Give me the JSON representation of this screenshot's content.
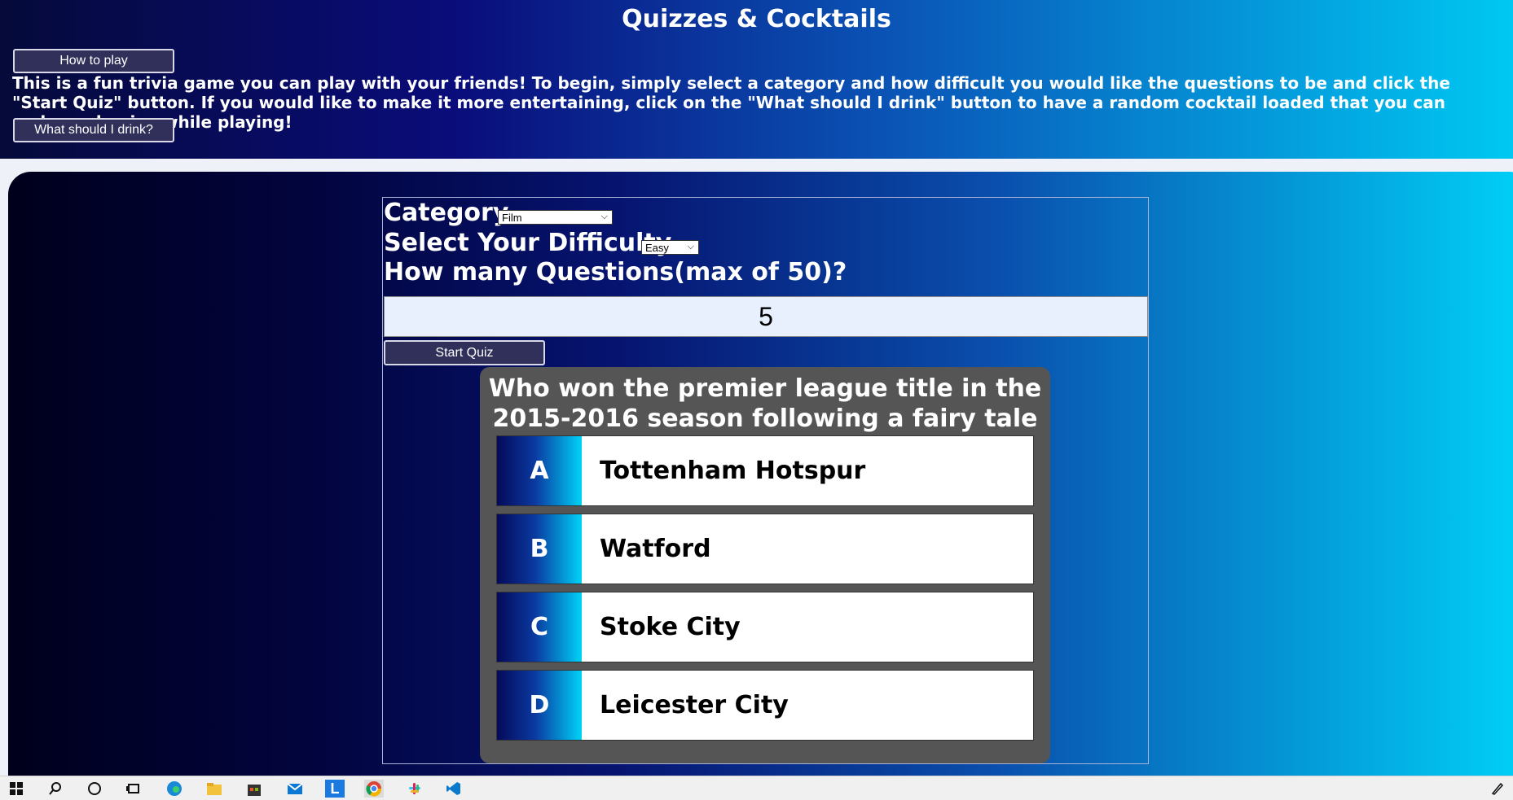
{
  "header": {
    "title": "Quizzes & Cocktails",
    "how_to_play_label": "How to play",
    "intro_text": "This is a fun trivia game you can play with your friends! To begin, simply select a category and how difficult you would like the questions to be and click the \"Start Quiz\" button. If you would like to make it more entertaining, click on the \"What should I drink\" button to have a random cocktail loaded that you can make and enjoy while playing!",
    "drink_label": "What should I drink?"
  },
  "form": {
    "category_label": "Category",
    "category_value": "Film",
    "difficulty_label": "Select Your Difficulty",
    "difficulty_value": "Easy",
    "count_label": "How many Questions(max of 50)?",
    "count_value": "5",
    "start_label": "Start Quiz"
  },
  "quiz": {
    "question": "Who won the premier league title in the 2015-2016 season following a fairy tale run?",
    "answers": [
      {
        "letter": "A",
        "text": "Tottenham Hotspur"
      },
      {
        "letter": "B",
        "text": "Watford"
      },
      {
        "letter": "C",
        "text": "Stoke City"
      },
      {
        "letter": "D",
        "text": "Leicester City"
      }
    ]
  },
  "taskbar": {
    "icons": [
      "windows-start-icon",
      "search-icon",
      "cortana-icon",
      "task-view-icon",
      "edge-icon",
      "file-explorer-icon",
      "store-icon",
      "mail-icon",
      "l-app-icon",
      "chrome-icon",
      "slack-icon",
      "vscode-icon",
      "pen-icon"
    ]
  },
  "colors": {
    "header_gradient": [
      "#050a3a",
      "#0a0c7a",
      "#0a57b8",
      "#00c8f2"
    ],
    "button_bg": "#30305a",
    "quiz_card": "#555555"
  }
}
